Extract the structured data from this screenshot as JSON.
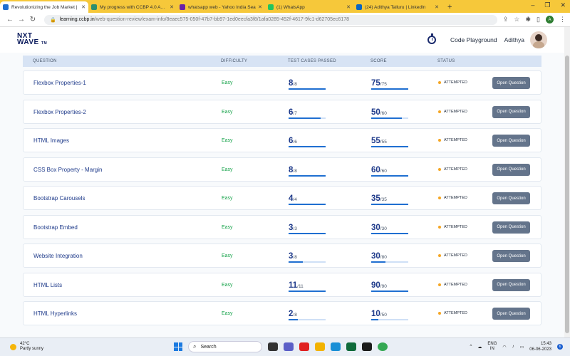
{
  "browser": {
    "tabs": [
      {
        "title": "Revolutionizing the Job Market |",
        "favicon_color": "#1f6fd1",
        "active": true
      },
      {
        "title": "My progress with CCBP 4.0 Acad",
        "favicon_color": "#2d8f6f",
        "active": false
      },
      {
        "title": "whatsapp web - Yahoo India Sea",
        "favicon_color": "#6b21a8",
        "active": false
      },
      {
        "title": "(1) WhatsApp",
        "favicon_color": "#22c55e",
        "active": false
      },
      {
        "title": "(24) Adithya Talluru | LinkedIn",
        "favicon_color": "#0a66c2",
        "active": false
      }
    ],
    "url_domain": "learning.ccbp.in",
    "url_path": "/web-question-review/exam-info/8eaec575-050f-47b7-bb97-1ed0eecfa3f8/1afa0285-452f-4617-9fc1-d62705ec6178",
    "profile_initial": "A"
  },
  "header": {
    "logo_line1": "NXT",
    "logo_line2": "WAVE",
    "logo_tm": "TM",
    "code_playground": "Code Playground",
    "user_name": "Adithya"
  },
  "table": {
    "headers": {
      "question": "QUESTION",
      "difficulty": "DIFFICULTY",
      "tests": "TEST CASES PASSED",
      "score": "SCORE",
      "status": "STATUS"
    },
    "rows": [
      {
        "question": "Flexbox Properties-1",
        "difficulty": "Easy",
        "passed": "8",
        "total_tests": "/8",
        "tests_ratio": 1.0,
        "score": "75",
        "max_score": "/75",
        "score_ratio": 1.0,
        "status": "ATTEMPTED",
        "button": "Open Question"
      },
      {
        "question": "Flexbox Properties-2",
        "difficulty": "Easy",
        "passed": "6",
        "total_tests": "/7",
        "tests_ratio": 0.857,
        "score": "50",
        "max_score": "/60",
        "score_ratio": 0.833,
        "status": "ATTEMPTED",
        "button": "Open Question"
      },
      {
        "question": "HTML Images",
        "difficulty": "Easy",
        "passed": "6",
        "total_tests": "/6",
        "tests_ratio": 1.0,
        "score": "55",
        "max_score": "/55",
        "score_ratio": 1.0,
        "status": "ATTEMPTED",
        "button": "Open Question"
      },
      {
        "question": "CSS Box Property - Margin",
        "difficulty": "Easy",
        "passed": "8",
        "total_tests": "/8",
        "tests_ratio": 1.0,
        "score": "60",
        "max_score": "/60",
        "score_ratio": 1.0,
        "status": "ATTEMPTED",
        "button": "Open Question"
      },
      {
        "question": "Bootstrap Carousels",
        "difficulty": "Easy",
        "passed": "4",
        "total_tests": "/4",
        "tests_ratio": 1.0,
        "score": "35",
        "max_score": "/35",
        "score_ratio": 1.0,
        "status": "ATTEMPTED",
        "button": "Open Question"
      },
      {
        "question": "Bootstrap Embed",
        "difficulty": "Easy",
        "passed": "3",
        "total_tests": "/3",
        "tests_ratio": 1.0,
        "score": "30",
        "max_score": "/30",
        "score_ratio": 1.0,
        "status": "ATTEMPTED",
        "button": "Open Question"
      },
      {
        "question": "Website Integration",
        "difficulty": "Easy",
        "passed": "3",
        "total_tests": "/8",
        "tests_ratio": 0.375,
        "score": "30",
        "max_score": "/80",
        "score_ratio": 0.375,
        "status": "ATTEMPTED",
        "button": "Open Question"
      },
      {
        "question": "HTML Lists",
        "difficulty": "Easy",
        "passed": "11",
        "total_tests": "/11",
        "tests_ratio": 1.0,
        "score": "90",
        "max_score": "/90",
        "score_ratio": 1.0,
        "status": "ATTEMPTED",
        "button": "Open Question"
      },
      {
        "question": "HTML Hyperlinks",
        "difficulty": "Easy",
        "passed": "2",
        "total_tests": "/8",
        "tests_ratio": 0.25,
        "score": "10",
        "max_score": "/50",
        "score_ratio": 0.2,
        "status": "ATTEMPTED",
        "button": "Open Question"
      }
    ]
  },
  "taskbar": {
    "temperature": "42°C",
    "weather": "Partly sunny",
    "search_label": "Search",
    "lang_line1": "ENG",
    "lang_line2": "IN",
    "time": "15:43",
    "date": "06-06-2023",
    "notification_count": "6"
  }
}
